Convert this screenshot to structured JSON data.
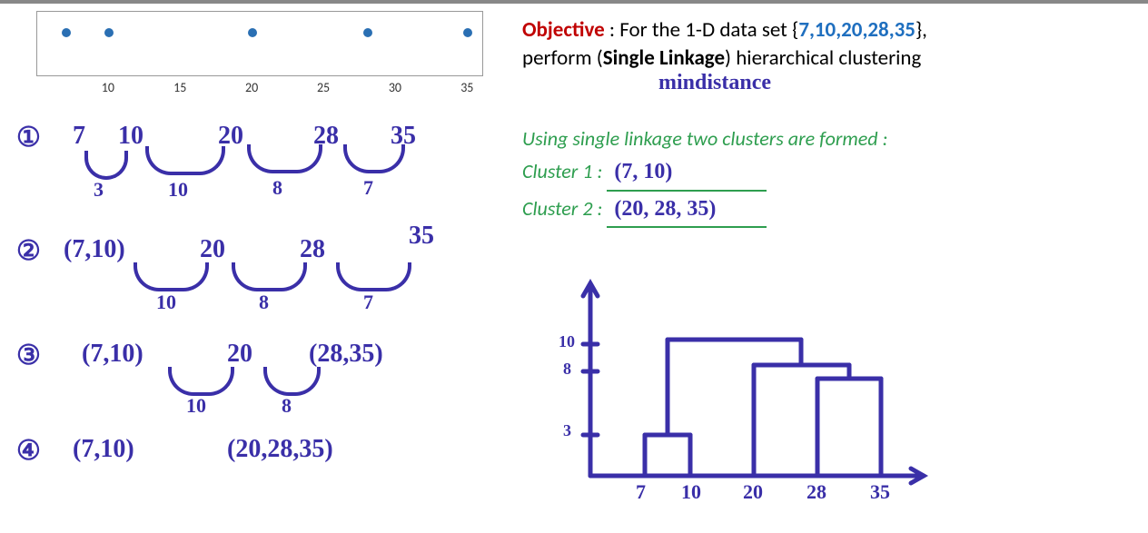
{
  "chart_data": {
    "type": "scatter",
    "x": [
      7,
      10,
      20,
      28,
      35
    ],
    "y": [
      0,
      0,
      0,
      0,
      0
    ],
    "title": "",
    "xlabel": "",
    "ylabel": "",
    "xlim": [
      5,
      36
    ],
    "ylim": [
      -1.0,
      0.5
    ],
    "x_ticks": [
      10,
      15,
      20,
      25,
      30,
      35
    ],
    "y_ticks": [
      0.0,
      -1.0
    ]
  },
  "objective": {
    "label": "Objective",
    "prefix": " : For the 1-D data set {",
    "data_set": "7,10,20,28,35",
    "suffix": "},",
    "line2a": "perform (",
    "linkage": "Single Linkage",
    "line2b": ") hierarchical clustering",
    "note": "mindistance"
  },
  "result": {
    "heading": "Using single linkage two clusters are formed :",
    "c1_label": "Cluster 1 :",
    "c1_value": "(7, 10)",
    "c2_label": "Cluster 2 :",
    "c2_value": "(20, 28, 35)"
  },
  "steps": {
    "s1": {
      "num": "①",
      "vals": [
        "7",
        "10",
        "20",
        "28",
        "35"
      ],
      "dists": [
        "3",
        "10",
        "8",
        "7"
      ]
    },
    "s2": {
      "num": "②",
      "vals": [
        "(7,10)",
        "20",
        "28",
        "35"
      ],
      "dists": [
        "10",
        "8",
        "7"
      ]
    },
    "s3": {
      "num": "③",
      "vals": [
        "(7,10)",
        "20",
        "(28,35)"
      ],
      "dists": [
        "10",
        "8"
      ]
    },
    "s4": {
      "num": "④",
      "vals": [
        "(7,10)",
        "(20,28,35)"
      ]
    }
  },
  "dendro": {
    "y_ticks": [
      "10",
      "8",
      "3"
    ],
    "x_ticks": [
      "7",
      "10",
      "20",
      "28",
      "35"
    ]
  }
}
